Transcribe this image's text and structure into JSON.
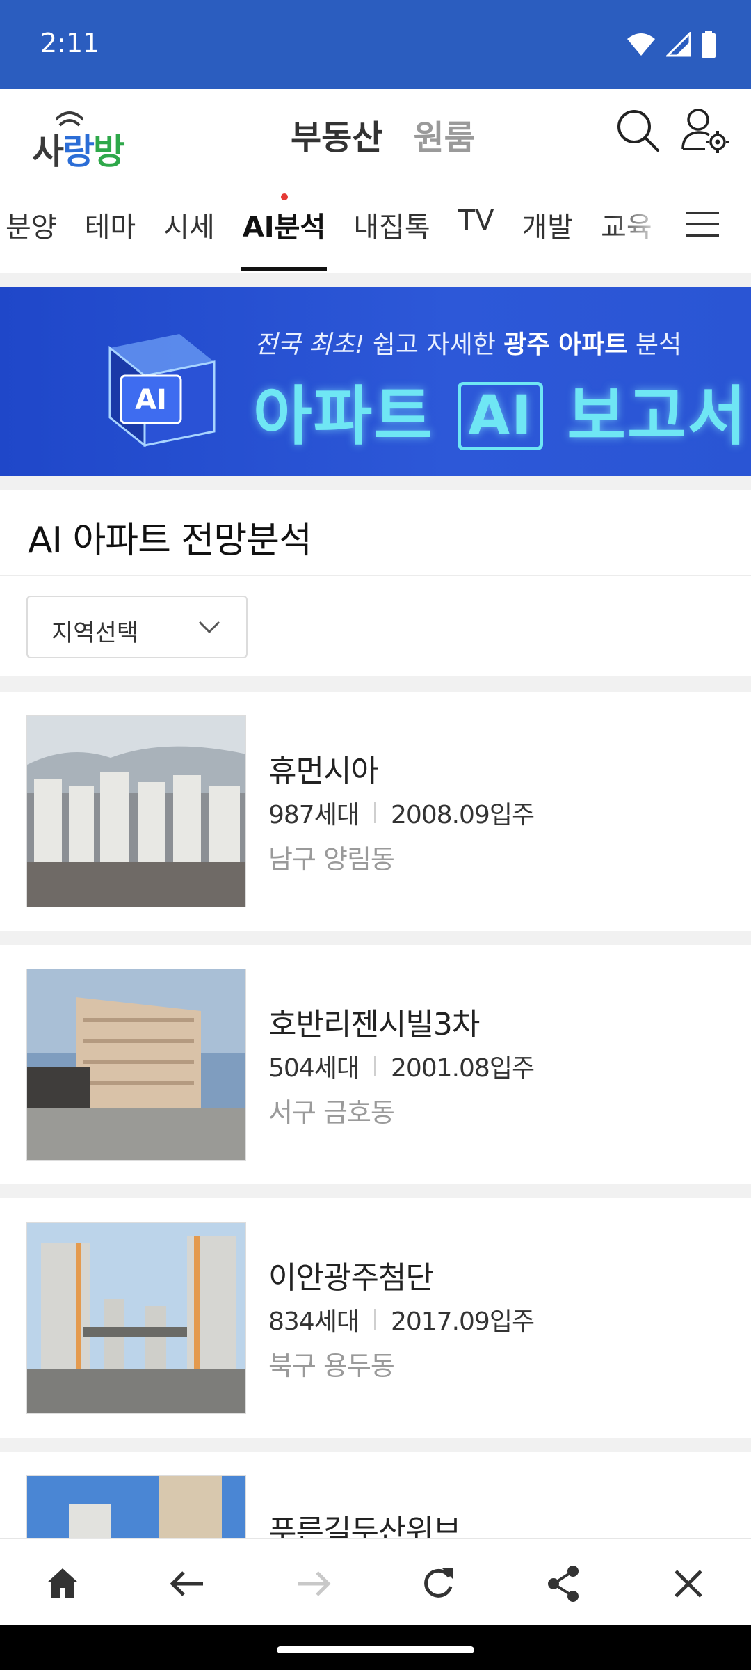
{
  "status": {
    "time": "2:11"
  },
  "header": {
    "logo": {
      "part1": "사",
      "part2": "랑",
      "part3": "방"
    },
    "tabs": [
      {
        "label": "부동산",
        "active": true
      },
      {
        "label": "원룸",
        "active": false
      }
    ]
  },
  "categories": {
    "items": [
      "분양",
      "테마",
      "시세",
      "AI분석",
      "내집톡",
      "TV",
      "개발",
      "교육"
    ],
    "active_index": 3
  },
  "banner": {
    "line1_prefix": "전국 최초!",
    "line1_mid": " 쉽고 자세한 ",
    "line1_highlight": "광주 아파트",
    "line1_suffix": " 분석",
    "line2_left": "아파트",
    "line2_badge": "AI",
    "line2_right": "보고서",
    "cube_label": "AI"
  },
  "section": {
    "title": "AI 아파트 전망분석"
  },
  "region_select": {
    "label": "지역선택"
  },
  "apartments": [
    {
      "name": "휴먼시아",
      "households": "987세대",
      "movein": "2008.09입주",
      "area": "남구 양림동"
    },
    {
      "name": "호반리젠시빌3차",
      "households": "504세대",
      "movein": "2001.08입주",
      "area": "서구 금호동"
    },
    {
      "name": "이안광주첨단",
      "households": "834세대",
      "movein": "2017.09입주",
      "area": "북구 용두동"
    },
    {
      "name": "푸른길두산위브"
    }
  ],
  "colors": {
    "status_bar": "#2b5dbf",
    "banner": "#2d58d8",
    "banner_text": "#6fe6f4",
    "active_dot": "#e53935"
  },
  "icons": {
    "status": [
      "wifi-icon",
      "signal-icon",
      "battery-icon"
    ],
    "header": [
      "search-icon",
      "user-settings-icon"
    ],
    "toolbar": [
      "home-icon",
      "back-arrow-icon",
      "forward-arrow-icon",
      "refresh-icon",
      "share-icon",
      "close-icon"
    ]
  }
}
